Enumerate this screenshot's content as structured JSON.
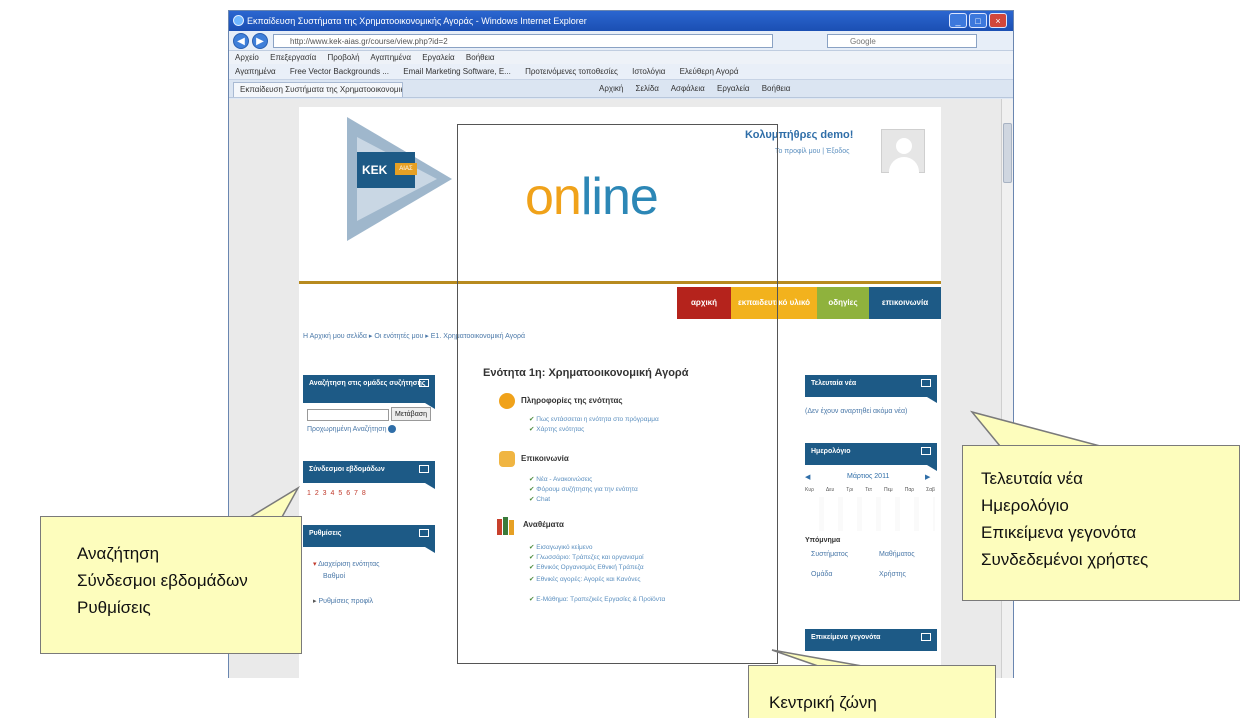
{
  "browser": {
    "title": "Εκπαίδευση Συστήματα της Χρηματοοικονομικής Αγοράς - Windows Internet Explorer",
    "address": "http://www.kek-aias.gr/course/view.php?id=2",
    "search_placeholder": "Google",
    "menu": [
      "Αρχείο",
      "Επεξεργασία",
      "Προβολή",
      "Αγαπημένα",
      "Εργαλεία",
      "Βοήθεια"
    ],
    "favorites": [
      "Αγαπημένα",
      "Free Vector Backgrounds ...",
      "Email Marketing Software, E...",
      "Προτεινόμενες τοποθεσίες",
      "Ιστολόγια",
      "Ελεύθερη Αγορά"
    ],
    "tab_label": "Εκπαίδευση Συστήματα της Χρηματοοικονομικής Αγοράς",
    "commands": [
      "Αρχική",
      "Σελίδα",
      "Ασφάλεια",
      "Εργαλεία",
      "Βοήθεια"
    ],
    "minimize": "_",
    "maximize": "□",
    "close": "×"
  },
  "site": {
    "kek_label": "ΚΕΚ",
    "kek_sub": "ΑΙΑΣ",
    "online_o": "on",
    "online_rest": "line",
    "user_name": "Κολυμπήθρες demo!",
    "user_links": "Το προφίλ μου | Έξοδος",
    "nav": [
      {
        "label": "αρχική",
        "color": "#b5231c"
      },
      {
        "label": "εκπαιδευτικό υλικό",
        "color": "#f2b21d"
      },
      {
        "label": "οδηγίες",
        "color": "#8fb23d"
      },
      {
        "label": "επικοινωνία",
        "color": "#1d5a86"
      }
    ],
    "breadcrumb": "Η Αρχική μου σελίδα ▸ Οι ενότητές μου ▸ Ε1. Χρηματοοικονομική Αγορά"
  },
  "left_blocks": {
    "search_title": "Αναζήτηση στις ομάδες συζήτησης",
    "search_button": "Μετάβαση",
    "advanced_search": "Προχωρημένη Αναζήτηση",
    "weeks_title": "Σύνδεσμοι εβδομάδων",
    "weeks_links": "1 2 3 4 5 6 7 8",
    "settings_title": "Ρυθμίσεις",
    "settings_item1": "Διαχείριση ενότητας",
    "settings_item2": "Βαθμοί",
    "settings_item3": "Ρυθμίσεις προφίλ"
  },
  "center": {
    "title": "Ενότητα 1η: Χρηματοοικονομική Αγορά",
    "sections": [
      {
        "title": "Πληροφορίες της ενότητας",
        "color": "#f0a21a",
        "items": [
          "Πως εντάσσεται η ενότητα στο πρόγραμμα",
          "Χάρτης ενότητας"
        ]
      },
      {
        "title": "Επικοινωνία",
        "color": "#f0b542",
        "items": [
          "Νέα - Ανακοινώσεις",
          "Φόρουμ συζήτησης για την ενότητα",
          "Chat"
        ]
      },
      {
        "title": "Αναθέματα",
        "color": "#c8402c",
        "items": [
          "Εισαγωγικό κείμενο",
          "Γλωσσάριο: Τράπεζες και οργανισμοί",
          "Εθνικός Οργανισμός Εθνική Τράπεζα",
          "Εθνικές αγορές: Αγορές και Κανόνες",
          "Ε-Μάθημα: Τραπεζικές Εργασίες & Προϊόντα"
        ]
      }
    ]
  },
  "right_blocks": {
    "news_title": "Τελευταία νέα",
    "news_text": "(Δεν έχουν αναρτηθεί ακόμα νέα)",
    "calendar_title": "Ημερολόγιο",
    "calendar_month": "Μάρτιος 2011",
    "calendar_days": [
      "Κυρ",
      "Δευ",
      "Τρι",
      "Τετ",
      "Πεμ",
      "Παρ",
      "Σαβ"
    ],
    "legend_title": "Υπόμνημα",
    "legend": [
      "Συστήματος",
      "Μαθήματος",
      "Ομάδα",
      "Χρήστης"
    ],
    "events_title": "Επικείμενα γεγονότα"
  },
  "callouts": {
    "left": [
      "Αναζήτηση",
      "Σύνδεσμοι εβδομάδων",
      "Ρυθμίσεις"
    ],
    "right": [
      "Τελευταία νέα",
      "Ημερολόγιο",
      "Επικείμενα γεγονότα",
      "Συνδεδεμένοι χρήστες"
    ],
    "bottom": "Κεντρική ζώνη"
  }
}
